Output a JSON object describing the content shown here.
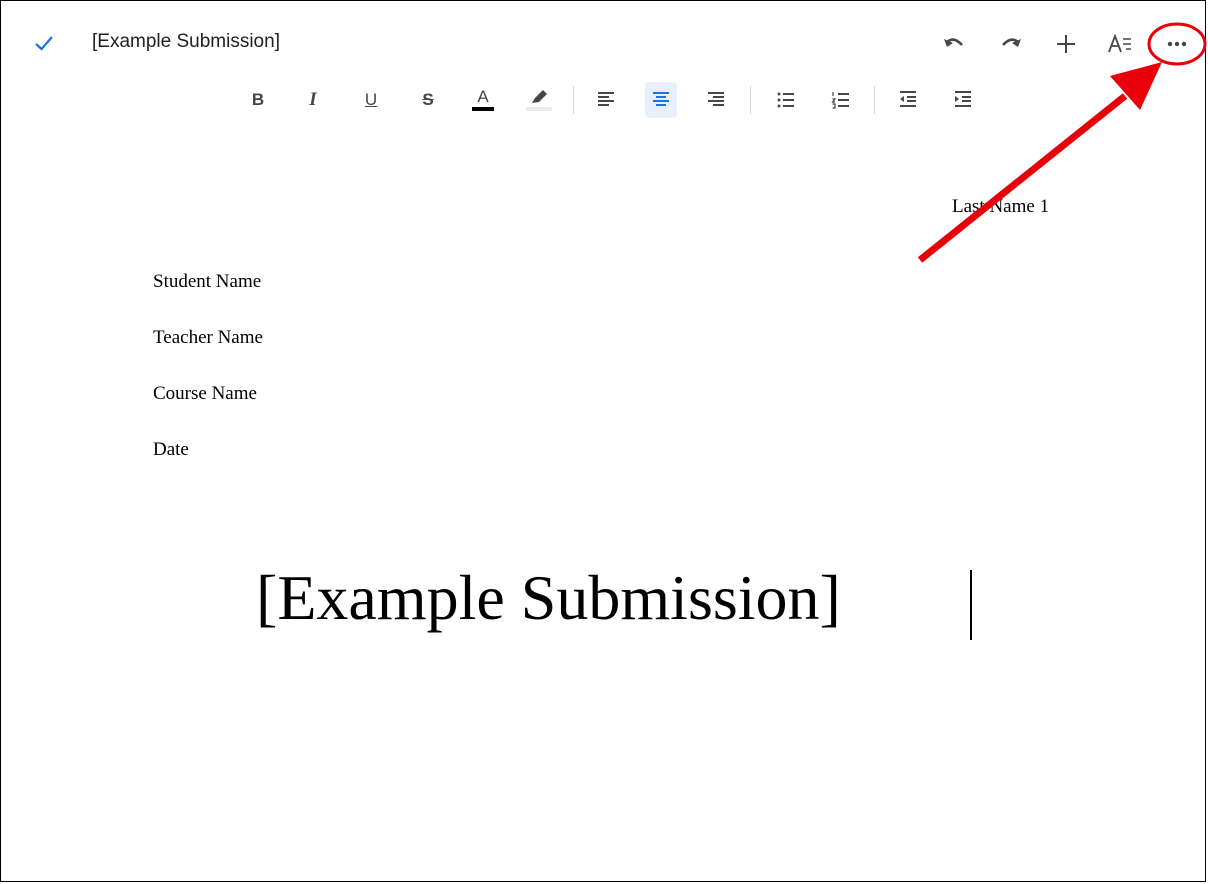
{
  "topbar": {
    "title": "[Example Submission]",
    "icons": [
      "check-icon",
      "undo-icon",
      "redo-icon",
      "plus-icon",
      "text-format-icon",
      "more-options-icon"
    ]
  },
  "toolbar": {
    "bold_label": "B",
    "italic_label": "I",
    "underline_label": "U",
    "strikethrough_label": "S",
    "text_color_label": "A",
    "active_alignment": "center"
  },
  "document": {
    "header": "Last Name 1",
    "lines": [
      "Student Name",
      "Teacher Name",
      "Course Name",
      "Date"
    ],
    "title": "[Example Submission]"
  },
  "colors": {
    "accent": "#1a73e8",
    "annotation": "#e8000b",
    "icon": "#444746"
  }
}
